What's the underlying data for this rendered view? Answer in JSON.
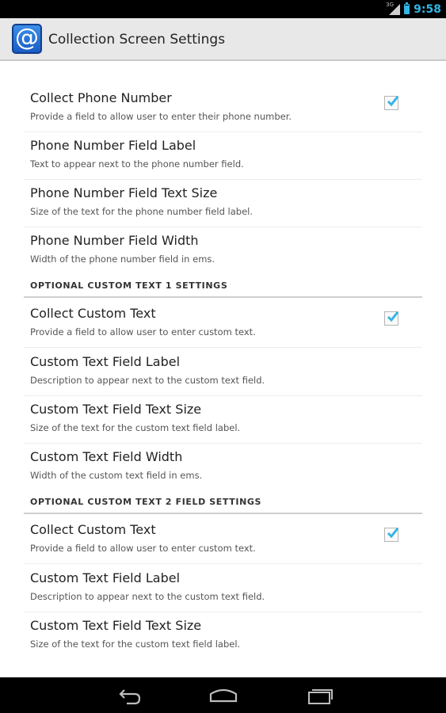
{
  "status_bar": {
    "time": "9:58",
    "network_label": "3G",
    "icons": [
      "signal-icon",
      "battery-icon"
    ]
  },
  "action_bar": {
    "app_icon_glyph": "@",
    "title": "Collection Screen Settings"
  },
  "preferences": [
    {
      "title": "Collect Phone Number",
      "summary": "Provide a field to allow user to enter their phone number.",
      "checked": true
    },
    {
      "title": "Phone Number Field Label",
      "summary": "Text to appear next to the phone number field."
    },
    {
      "title": "Phone Number Field Text Size",
      "summary": "Size of the text for the phone number field label."
    },
    {
      "title": "Phone Number Field Width",
      "summary": "Width of the phone number field in ems."
    },
    {
      "section": "OPTIONAL CUSTOM TEXT 1 SETTINGS"
    },
    {
      "title": "Collect Custom Text",
      "summary": "Provide a field to allow user to enter custom text.",
      "checked": true
    },
    {
      "title": "Custom Text Field Label",
      "summary": "Description to appear next to the custom text field."
    },
    {
      "title": "Custom Text Field Text Size",
      "summary": "Size of the text for the custom text field label."
    },
    {
      "title": "Custom Text Field Width",
      "summary": "Width of the custom text field in ems."
    },
    {
      "section": "OPTIONAL CUSTOM TEXT 2 FIELD SETTINGS"
    },
    {
      "title": "Collect Custom Text",
      "summary": "Provide a field to allow user to enter custom text.",
      "checked": true
    },
    {
      "title": "Custom Text Field Label",
      "summary": "Description to appear next to the custom text field."
    },
    {
      "title": "Custom Text Field Text Size",
      "summary": "Size of the text for the custom text field label."
    }
  ],
  "nav_bar": {
    "buttons": [
      "back-icon",
      "home-icon",
      "recent-apps-icon"
    ]
  },
  "colors": {
    "accent": "#33b5e5",
    "checkmark": "#33b5e5",
    "action_bar": "#e8e8e8",
    "divider": "#cfcfcf"
  }
}
